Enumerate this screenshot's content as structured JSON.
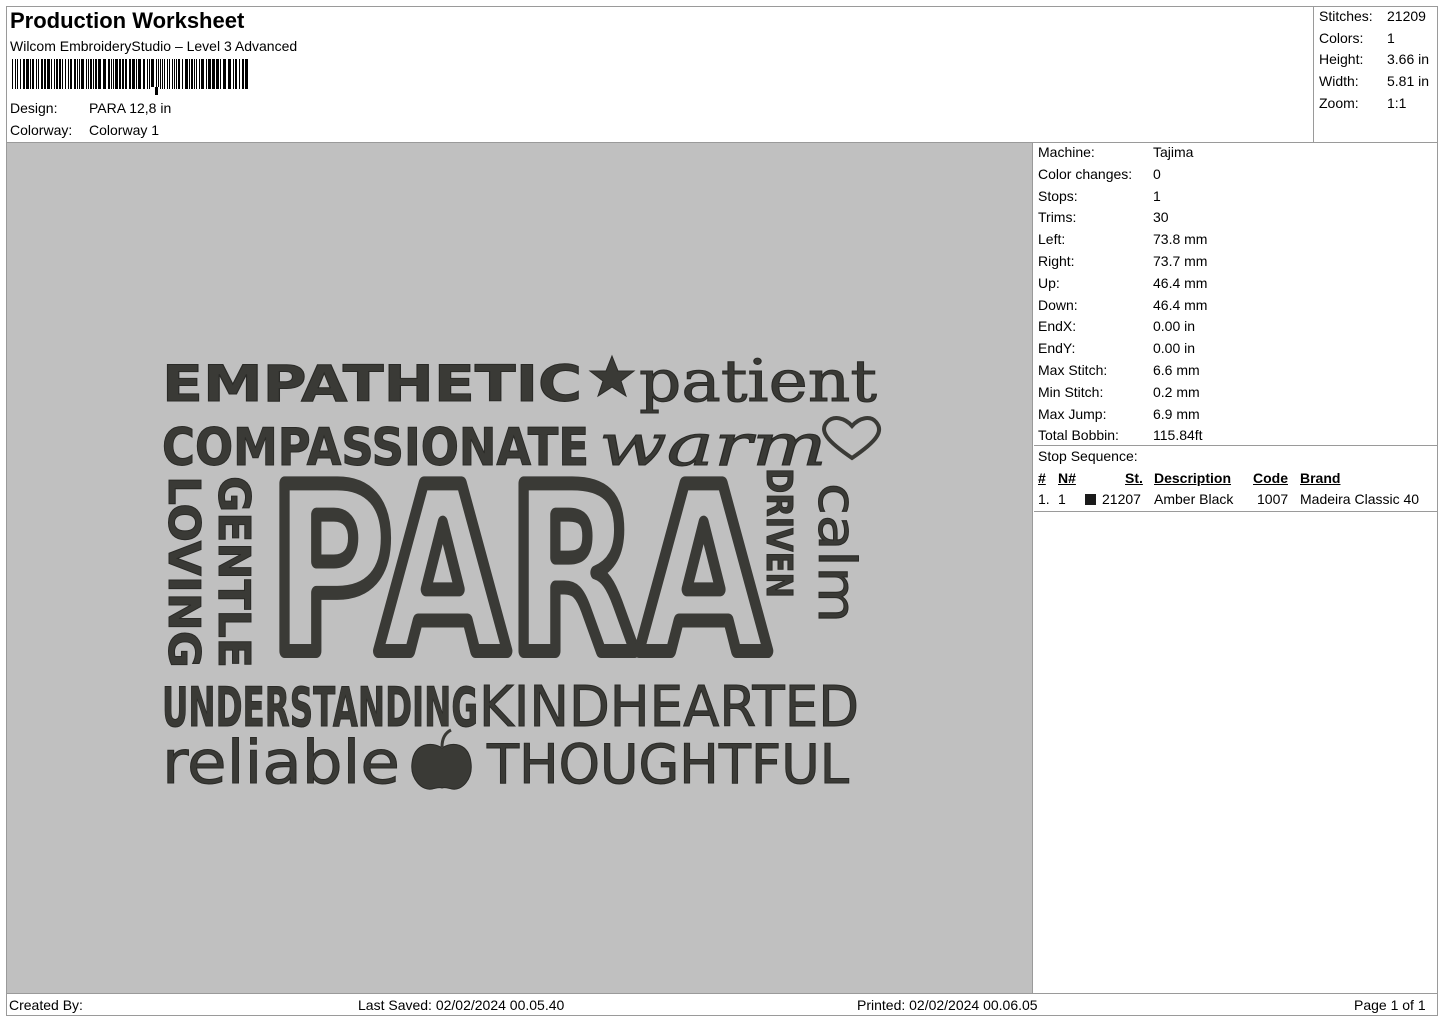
{
  "header": {
    "title": "Production Worksheet",
    "subtitle": "Wilcom EmbroideryStudio – Level 3 Advanced",
    "design_label": "Design:",
    "design_value": "PARA 12,8 in",
    "colorway_label": "Colorway:",
    "colorway_value": "Colorway 1"
  },
  "stats": [
    {
      "label": "Stitches:",
      "value": "21209"
    },
    {
      "label": "Colors:",
      "value": "1"
    },
    {
      "label": "Height:",
      "value": "3.66 in"
    },
    {
      "label": "Width:",
      "value": "5.81 in"
    },
    {
      "label": "Zoom:",
      "value": "1:1"
    }
  ],
  "design_preview": {
    "thread_color": "#3a3a36",
    "background_color": "#c0c0c0",
    "words": {
      "empathetic": "EMPATHETIC",
      "patient": "patient",
      "compassionate": "COMPASSIONATE",
      "warm": "warm",
      "loving": "LOVING",
      "gentle": "GENTLE",
      "para": "PARA",
      "driven": "DRIVEN",
      "calm": "calm",
      "understanding": "UNDERSTANDING",
      "kindhearted": "KINDHEARTED",
      "reliable": "reliable",
      "thoughtful": "THOUGHTFUL"
    },
    "icons": [
      "star-icon",
      "heart-icon",
      "apple-icon"
    ]
  },
  "machine_info": [
    {
      "label": "Machine:",
      "value": "Tajima"
    },
    {
      "label": "Color changes:",
      "value": "0"
    },
    {
      "label": "Stops:",
      "value": "1"
    },
    {
      "label": "Trims:",
      "value": "30"
    },
    {
      "label": "Left:",
      "value": "73.8 mm"
    },
    {
      "label": "Right:",
      "value": "73.7 mm"
    },
    {
      "label": "Up:",
      "value": "46.4 mm"
    },
    {
      "label": "Down:",
      "value": "46.4 mm"
    },
    {
      "label": "EndX:",
      "value": "0.00 in"
    },
    {
      "label": "EndY:",
      "value": "0.00 in"
    },
    {
      "label": "Max Stitch:",
      "value": "6.6 mm"
    },
    {
      "label": "Min Stitch:",
      "value": "0.2 mm"
    },
    {
      "label": "Max Jump:",
      "value": "6.9 mm"
    },
    {
      "label": "Total Bobbin:",
      "value": "115.84ft"
    }
  ],
  "stop_sequence": {
    "title": "Stop Sequence:",
    "columns": [
      "#",
      "N#",
      "St.",
      "Description",
      "Code",
      "Brand"
    ],
    "rows": [
      {
        "num": "1.",
        "n": "1",
        "swatch_color": "#1a1a1a",
        "stitches": "21207",
        "description": "Amber Black",
        "code": "1007",
        "brand": "Madeira Classic 40"
      }
    ]
  },
  "footer": {
    "created_by": "Created By:",
    "last_saved": "Last Saved: 02/02/2024 00.05.40",
    "printed": "Printed: 02/02/2024 00.06.05",
    "page": "Page 1 of 1"
  }
}
